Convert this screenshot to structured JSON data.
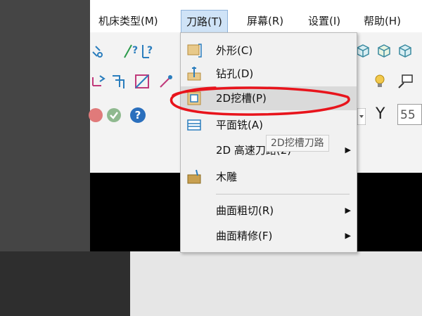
{
  "menubar": {
    "items": [
      {
        "label": "机床类型(M)"
      },
      {
        "label": "刀路(T)"
      },
      {
        "label": "屏幕(R)"
      },
      {
        "label": "设置(I)"
      },
      {
        "label": "帮助(H)"
      }
    ]
  },
  "toolpath_menu": {
    "items": [
      {
        "label": "外形(C)",
        "icon": "contour-icon"
      },
      {
        "label": "钻孔(D)",
        "icon": "drill-icon"
      },
      {
        "label": "2D挖槽(P)",
        "icon": "pocket-icon",
        "highlighted": true
      },
      {
        "label": "平面铣(A)",
        "icon": "facing-icon"
      },
      {
        "label": "2D 高速刀路(2)",
        "submenu": true
      },
      {
        "label": "木雕",
        "icon": "engrave-icon"
      },
      {
        "label": "曲面粗切(R)",
        "submenu": true
      },
      {
        "label": "曲面精修(F)",
        "submenu": true
      }
    ]
  },
  "tooltip": {
    "text": "2D挖槽刀路"
  },
  "coords": {
    "y_label": "Y",
    "y_value": "55"
  },
  "colors": {
    "annotation": "#e8141c",
    "highlight": "#dadada",
    "menu_active": "#cfe3f7"
  }
}
